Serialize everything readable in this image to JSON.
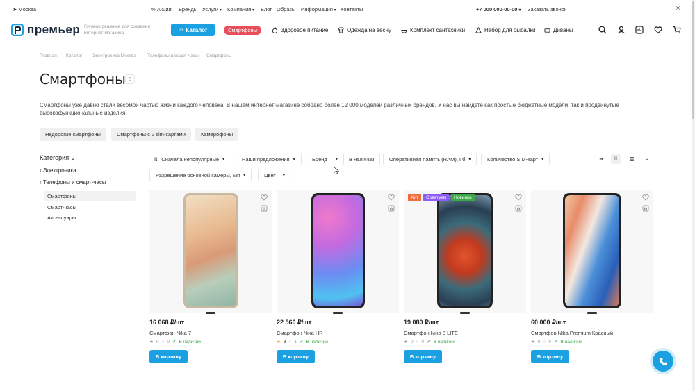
{
  "topbar": {
    "city": "Москва",
    "links": [
      "Акции",
      "Бренды",
      "Услуги",
      "Компания",
      "Блог",
      "Образы",
      "Информация",
      "Контакты"
    ],
    "phone": "+7 000 000-00-00",
    "callback": "Заказать звонок"
  },
  "header": {
    "logo": "премьер",
    "tagline_1": "Готовое решение для создания",
    "tagline_2": "интернет-магазина",
    "catalog_label": "Каталог",
    "smartphones_pill": "Смартфоны",
    "menu": [
      "Здоровое питание",
      "Одежда на весну",
      "Комплект сантехники",
      "Набор для рыбалки",
      "Диваны"
    ]
  },
  "breadcrumbs": [
    "Главная",
    "Каталог",
    "Электроника Москва",
    "Телефоны и смарт-часы",
    "Смартфоны"
  ],
  "page": {
    "title": "Смартфоны",
    "count": "6",
    "description": "Смартфоны уже давно стали весомой частью жизни каждого человека. В нашем интернет-магазине собрано более 12 000 моделей различных брендов. У нас вы найдете как простые бюджетные модели, так и продвинутые высокофункциональные изделия."
  },
  "tag_chips": [
    "Недорогие смартфоны",
    "Смартфоны с 2 sim-картами",
    "Камерофоны"
  ],
  "sidebar": {
    "title": "Категория",
    "parent_1": "Электроника",
    "parent_2": "Телефоны и смарт-часы",
    "items": [
      "Смартфоны",
      "Смарт-часы",
      "Аксессуары"
    ]
  },
  "filters": {
    "sort": "Сначала непопулярные",
    "row1": [
      "Наши предложения",
      "Бренд",
      "В наличии",
      "Оперативная память (RAM), Гб",
      "Количество SIM-карт"
    ],
    "row2": [
      "Разрешение основной камеры, Мп",
      "Цвет"
    ]
  },
  "products": [
    {
      "price": "16 068 ₽/шт",
      "name": "Смартфон Nika 7",
      "rating": "0",
      "reviews": "0",
      "stock": "В наличии",
      "cart": "В корзину"
    },
    {
      "price": "22 560 ₽/шт",
      "name": "Смартфон Nika HR",
      "rating": "3",
      "reviews": "1",
      "stock": "В наличии",
      "cart": "В корзину"
    },
    {
      "price": "19 080 ₽/шт",
      "name": "Смартфон Nika 8 LITE",
      "rating": "0",
      "reviews": "0",
      "stock": "В наличии",
      "cart": "В корзину",
      "badges": [
        "Хит",
        "Советуем",
        "Новинка"
      ]
    },
    {
      "price": "60 000 ₽/шт",
      "name": "Смартфон Nika Premium Красный",
      "rating": "0",
      "reviews": "0",
      "stock": "В наличии",
      "cart": "В корзину"
    }
  ],
  "colors": {
    "accent": "#1ba1e2",
    "red": "#e94e5b",
    "hit": "#f26d3d",
    "advise": "#8b5cf6",
    "new": "#3aa845"
  }
}
